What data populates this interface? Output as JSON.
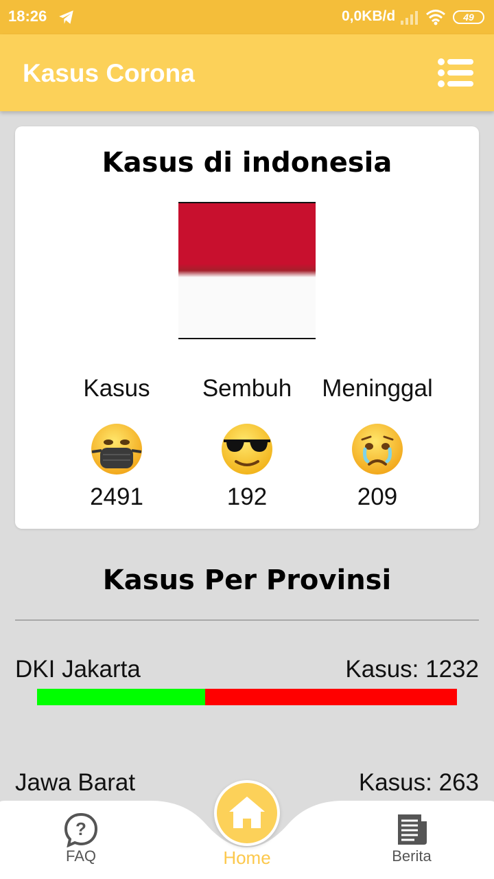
{
  "status_bar": {
    "time": "18:26",
    "net_speed": "0,0KB/d",
    "battery": "49"
  },
  "app_bar": {
    "title": "Kasus Corona",
    "menu_icon": "list-menu-icon"
  },
  "summary": {
    "title": "Kasus di indonesia",
    "flag": "indonesia-flag",
    "stats": [
      {
        "label": "Kasus",
        "value": "2491",
        "emoji": "mask-face-emoji"
      },
      {
        "label": "Sembuh",
        "value": "192",
        "emoji": "sunglasses-face-emoji"
      },
      {
        "label": "Meninggal",
        "value": "209",
        "emoji": "crying-face-emoji"
      }
    ]
  },
  "provinces": {
    "title": "Kasus Per Provinsi",
    "items": [
      {
        "name": "DKI Jakarta",
        "count": "Kasus: 1232",
        "green_fraction": 0.4
      },
      {
        "name": "Jawa Barat",
        "count": "Kasus: 263"
      }
    ]
  },
  "colors": {
    "accent": "#fcd159",
    "status_bar": "#f4be3a",
    "progress_green": "#00ff00",
    "progress_red": "#ff0000"
  },
  "bottom_nav": {
    "items": [
      {
        "label": "FAQ",
        "icon": "question-bubble-icon"
      },
      {
        "label": "Home",
        "icon": "home-icon"
      },
      {
        "label": "Berita",
        "icon": "newspaper-icon"
      }
    ]
  }
}
